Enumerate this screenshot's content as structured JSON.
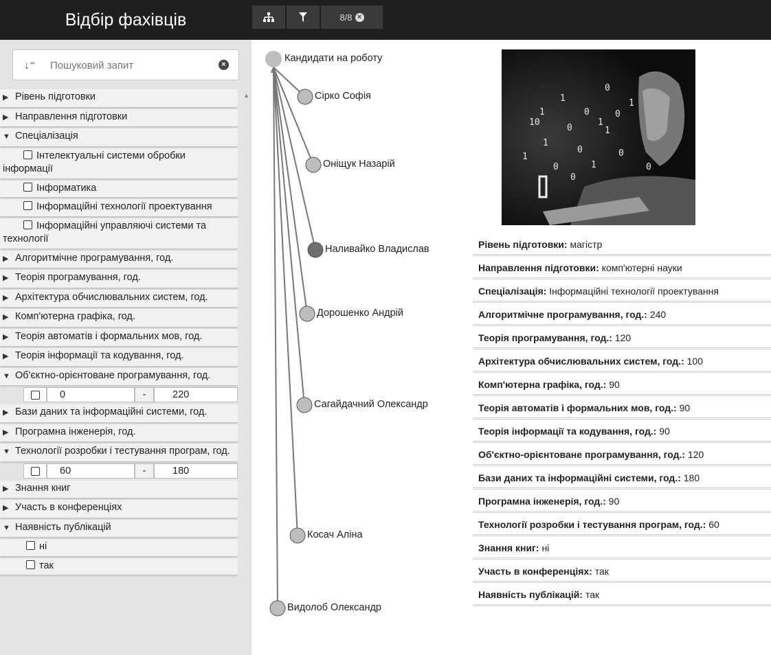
{
  "app": {
    "title": "Відбір фахівців"
  },
  "toolbar": {
    "tree_icon": "sitemap-icon",
    "filter_icon": "filter-icon",
    "count_label": "8/8",
    "clear_icon": "times-circle-icon"
  },
  "search": {
    "placeholder": "Пошуковий запит",
    "sort_icon": "sort-icon",
    "clear_icon": "times-circle-icon"
  },
  "filters": {
    "level": "Рівень підготовки",
    "direction": "Направлення підготовки",
    "specialization": "Спеціалізація",
    "spec_options": [
      "Інтелектуальні системи обробки інформації",
      "Інформатика",
      "Інформаційні технології проектування",
      "Інформаційні управляючі системи та технології"
    ],
    "algo": "Алгоритмічне програмування, год.",
    "theory_prog": "Теорія програмування, год.",
    "arch": "Архітектура обчислювальних систем, год.",
    "graphics": "Комп'ютерна графіка, год.",
    "automata": "Теорія автоматів і формальних мов, год.",
    "info_theory": "Теорія інформації та кодування, год.",
    "oop": "Об'єктно-орієнтоване програмування, год.",
    "oop_range": {
      "from": "0",
      "dash": "-",
      "to": "220"
    },
    "db": "Бази даних та інформаційні системи, год.",
    "se": "Програмна інженерія, год.",
    "testing": "Технології розробки і тестування програм, год.",
    "testing_range": {
      "from": "60",
      "dash": "-",
      "to": "180"
    },
    "books": "Знання книг",
    "conferences": "Участь в конференціях",
    "publications": "Наявність публікацій",
    "pub_options": [
      "ні",
      "так"
    ]
  },
  "tree": {
    "root": "Кандидати на роботу",
    "candidates": [
      "Сірко Софія",
      "Оніщук Назарій",
      "Наливайко Владислав",
      "Дорошенко Андрій",
      "Сагайдачний Олександр",
      "Косач Аліна",
      "Видолоб Олександр"
    ],
    "selected_index": 2,
    "colors": {
      "node": "#bdbdbd",
      "selected": "#6e6e6e",
      "link": "#777777"
    }
  },
  "details": [
    {
      "k": "Рівень підготовки:",
      "v": "магістр"
    },
    {
      "k": "Направлення підготовки:",
      "v": "комп'ютерні науки"
    },
    {
      "k": "Спеціалізація:",
      "v": "Інформаційні технології проектування"
    },
    {
      "k": "Алгоритмічне програмування, год.:",
      "v": "240"
    },
    {
      "k": "Теорія програмування, год.:",
      "v": "120"
    },
    {
      "k": "Архітектура обчислювальних систем, год.:",
      "v": "100"
    },
    {
      "k": "Комп'ютерна графіка, год.:",
      "v": "90"
    },
    {
      "k": "Теорія автоматів і формальних мов, год.:",
      "v": "90"
    },
    {
      "k": "Теорія інформації та кодування, год.:",
      "v": "90"
    },
    {
      "k": "Об'єктно-орієнтоване програмування, год.:",
      "v": "120"
    },
    {
      "k": "Бази даних та інформаційні системи, год.:",
      "v": "180"
    },
    {
      "k": "Програмна інженерія, год.:",
      "v": "90"
    },
    {
      "k": "Технології розробки і тестування програм, год.:",
      "v": "60"
    },
    {
      "k": "Знання книг:",
      "v": "ні"
    },
    {
      "k": "Участь в конференціях:",
      "v": "так"
    },
    {
      "k": "Наявність публікацій:",
      "v": "так"
    }
  ]
}
